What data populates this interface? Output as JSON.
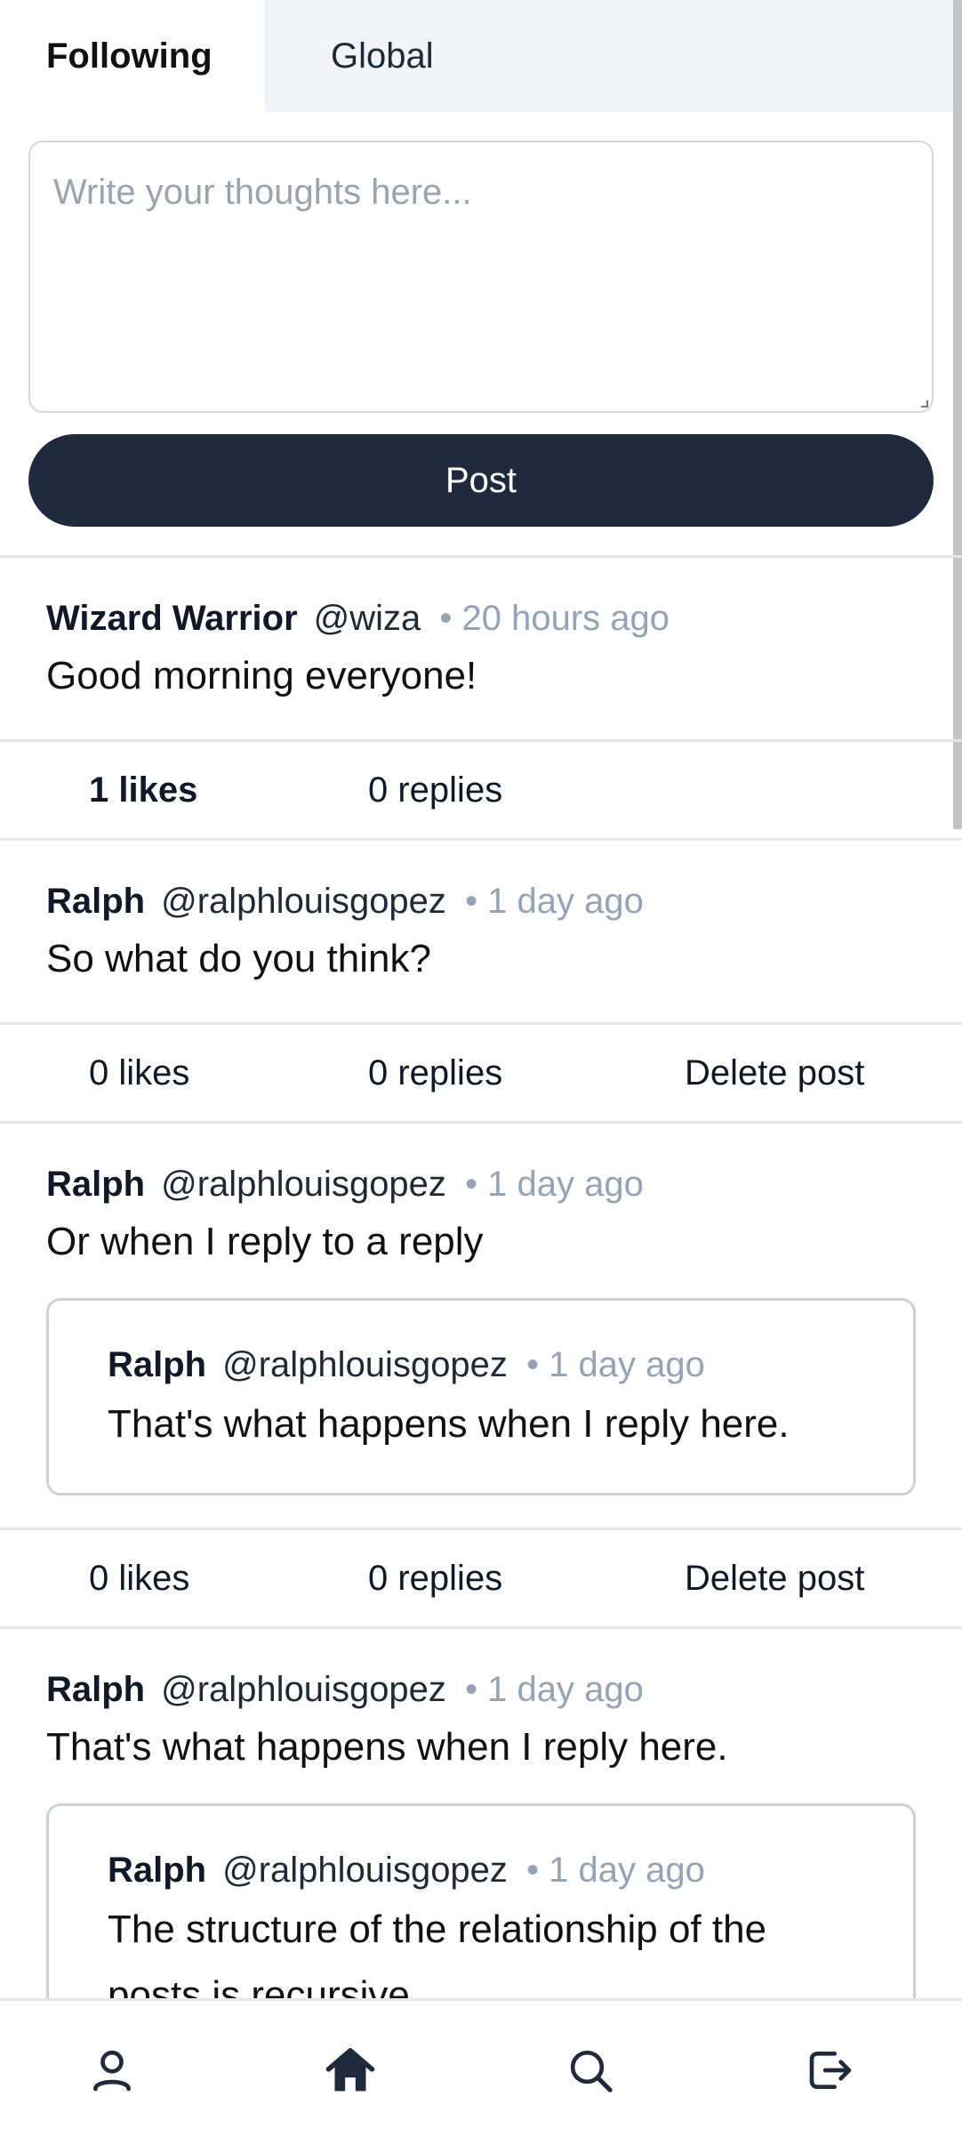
{
  "tabs": {
    "following": "Following",
    "global": "Global"
  },
  "composer": {
    "placeholder": "Write your thoughts here...",
    "post_button": "Post"
  },
  "posts": [
    {
      "name": "Wizard Warrior",
      "handle": "@wiza",
      "time": "• 20 hours ago",
      "text": "Good morning everyone!",
      "likes": "1 likes",
      "replies": "0 replies"
    },
    {
      "name": "Ralph",
      "handle": "@ralphlouisgopez",
      "time": "• 1 day ago",
      "text": "So what do you think?",
      "likes": "0 likes",
      "replies": "0 replies",
      "delete": "Delete post"
    },
    {
      "name": "Ralph",
      "handle": "@ralphlouisgopez",
      "time": "• 1 day ago",
      "text": "Or when I reply to a reply",
      "quote": {
        "name": "Ralph",
        "handle": "@ralphlouisgopez",
        "time": "• 1 day ago",
        "text": "That's what happens when I reply here."
      },
      "likes": "0 likes",
      "replies": "0 replies",
      "delete": "Delete post"
    },
    {
      "name": "Ralph",
      "handle": "@ralphlouisgopez",
      "time": "• 1 day ago",
      "text": "That's what happens when I reply here.",
      "quote": {
        "name": "Ralph",
        "handle": "@ralphlouisgopez",
        "time": "• 1 day ago",
        "text": "The structure of the relationship of the posts is recursive"
      }
    }
  ],
  "nav": {
    "icons": [
      "user-icon",
      "home-icon",
      "search-icon",
      "logout-icon"
    ],
    "icon_color": "#1f2a3c"
  },
  "colors": {
    "accent": "#1f2a3c",
    "muted": "#94a3b8",
    "tab_inactive_bg": "#f1f3f7"
  }
}
